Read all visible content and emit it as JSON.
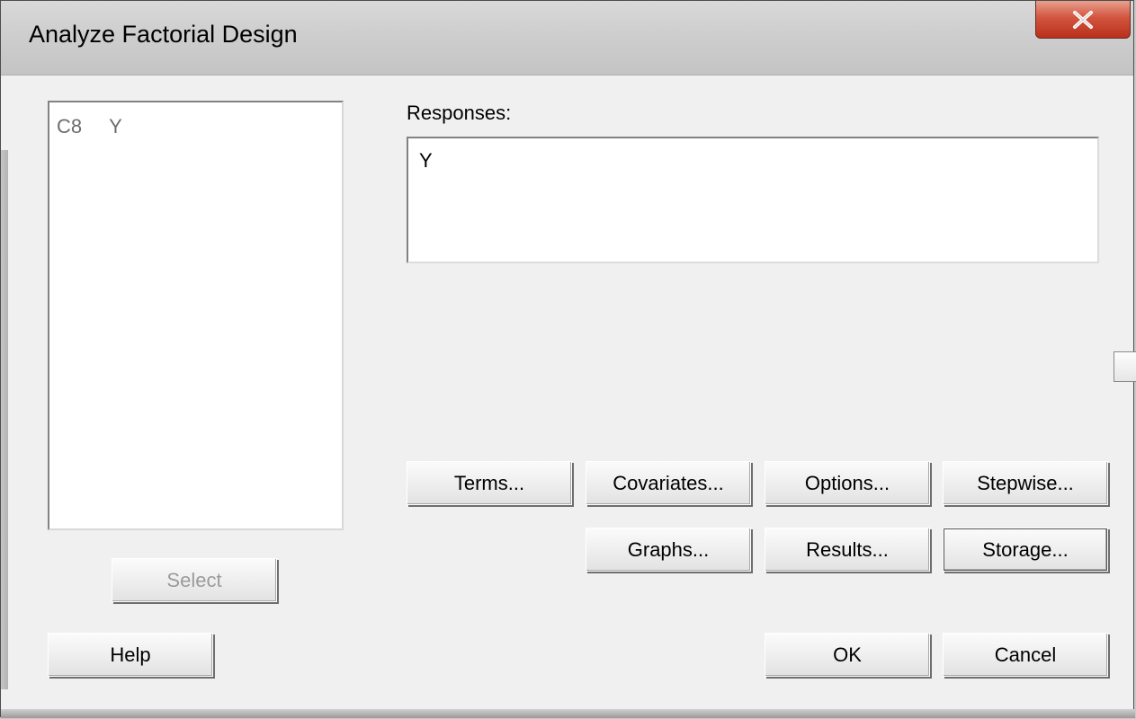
{
  "window": {
    "title": "Analyze Factorial Design"
  },
  "icons": {
    "close": "close-icon"
  },
  "variables": {
    "items": [
      {
        "column": "C8",
        "name": "Y"
      }
    ]
  },
  "responses": {
    "label": "Responses:",
    "value": "Y"
  },
  "buttons": {
    "terms": "Terms...",
    "covariates": "Covariates...",
    "options": "Options...",
    "stepwise": "Stepwise...",
    "graphs": "Graphs...",
    "results": "Results...",
    "storage": "Storage...",
    "select": "Select",
    "help": "Help",
    "ok": "OK",
    "cancel": "Cancel"
  },
  "colors": {
    "close_button": "#c7432d",
    "disabled_text": "#9b9b9b"
  }
}
